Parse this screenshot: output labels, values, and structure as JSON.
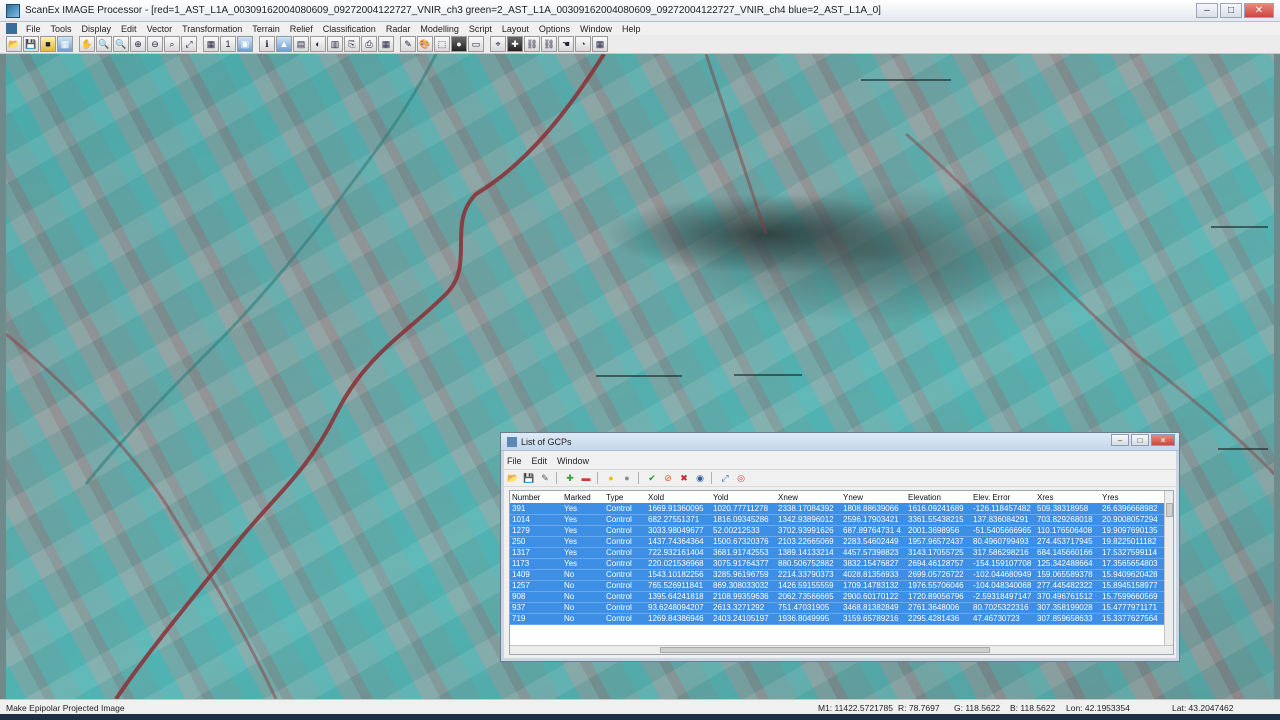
{
  "window": {
    "title": "ScanEx IMAGE Processor - [red=1_AST_L1A_00309162004080609_09272004122727_VNIR_ch3  green=2_AST_L1A_00309162004080609_09272004122727_VNIR_ch4  blue=2_AST_L1A_0]",
    "controls": {
      "minimize": "–",
      "maximize": "□",
      "close": "✕"
    }
  },
  "menubar": [
    "File",
    "Tools",
    "Display",
    "Edit",
    "Vector",
    "Transformation",
    "Terrain",
    "Relief",
    "Classification",
    "Radar",
    "Modelling",
    "Script",
    "Layout",
    "Options",
    "Window",
    "Help"
  ],
  "toolbar": {
    "icons": [
      "open-icon",
      "save-icon",
      "yellow-icon",
      "layers-icon",
      "pan-icon",
      "zoom-in-icon",
      "zoom-out-icon",
      "zoom-box-icon",
      "zoom-fit-icon",
      "zoom-icon",
      "fit-window-icon",
      "grid-icon",
      "zoom-actual-icon",
      "frame-icon",
      "info-icon",
      "blue-chart-icon",
      "histogram-icon",
      "contrast-icon",
      "band-icon",
      "copy-icon",
      "print-icon",
      "grid2-icon",
      "tool-icon",
      "color-icon",
      "select-icon",
      "record-icon",
      "window-icon",
      "pin-icon",
      "crosshair-icon",
      "link-icon",
      "link2-icon",
      "hand-icon",
      "gauge-icon",
      "table-icon"
    ],
    "glyphs": [
      "📂",
      "💾",
      "■",
      "▦",
      "✋",
      "🔍",
      "🔍",
      "⊕",
      "⊖",
      "⌕",
      "⤢",
      "▦",
      "1",
      "▣",
      "ℹ",
      "▲",
      "▤",
      "◐",
      "▥",
      "⎘",
      "⎙",
      "▦",
      "✎",
      "🎨",
      "⬚",
      "●",
      "▭",
      "⌖",
      "✚",
      "⛓",
      "⛓",
      "☚",
      "◔",
      "▦"
    ]
  },
  "gcp_dialog": {
    "title": "List of GCPs",
    "menu": [
      "File",
      "Edit",
      "Window"
    ],
    "controls": {
      "minimize": "–",
      "maximize": "□",
      "close": "✕"
    },
    "tools": [
      {
        "name": "open-icon",
        "glyph": "📂"
      },
      {
        "name": "save-icon",
        "glyph": "💾"
      },
      {
        "name": "edit-icon",
        "glyph": "✎"
      },
      {
        "name": "add-point-icon",
        "glyph": "✚"
      },
      {
        "name": "remove-point-icon",
        "glyph": "▬"
      },
      {
        "name": "yellow-circle-icon",
        "glyph": "●"
      },
      {
        "name": "gray-circle-icon",
        "glyph": "●"
      },
      {
        "name": "check-icon",
        "glyph": "✔"
      },
      {
        "name": "stop-icon",
        "glyph": "⊘"
      },
      {
        "name": "delete-icon",
        "glyph": "✖"
      },
      {
        "name": "globe-icon",
        "glyph": "◉"
      },
      {
        "name": "link-icon",
        "glyph": "⤢"
      },
      {
        "name": "target-icon",
        "glyph": "◎"
      }
    ],
    "columns": [
      "Number",
      "Marked",
      "Type",
      "Xold",
      "Yold",
      "Xnew",
      "Ynew",
      "Elevation",
      "Elev. Error",
      "Xres",
      "Yres"
    ],
    "rows": [
      [
        "391",
        "Yes",
        "Control",
        "1669.91360095",
        "1020.77711278",
        "2338.17084392",
        "1808.88639066",
        "1616.09241689",
        "-126.118457482",
        "509.38318958",
        "26.6396668982"
      ],
      [
        "1014",
        "Yes",
        "Control",
        "682.27551371",
        "1816.09345286",
        "1342.93896012",
        "2596.17903421",
        "3361.55438215",
        "137.836084291",
        "703.829268018",
        "20.9008057294"
      ],
      [
        "1279",
        "Yes",
        "Control",
        "3033.98049677",
        "52.00212533",
        "3702.93991626",
        "687.89764731 4",
        "2001.3698956",
        "-51.5405666965",
        "110.176506408",
        "19.9097690135"
      ],
      [
        "250",
        "Yes",
        "Control",
        "1437.74364364",
        "1500.67320376",
        "2103.22665069",
        "2283.54602449",
        "1957.96572437",
        "80.4960799493",
        "274.453717945",
        "19.8225011182"
      ],
      [
        "1317",
        "Yes",
        "Control",
        "722.932161404",
        "3681.91742553",
        "1389.14133214",
        "4457.57398823",
        "3143.17055725",
        "317.586298216",
        "684.145660166",
        "17.5327599114"
      ],
      [
        "1173",
        "Yes",
        "Control",
        "220.021536968",
        "3075.91764377",
        "880.506752882",
        "3832.15476827",
        "2694.46128757",
        "-154.159107708",
        "125.342488664",
        "17.3565654803"
      ],
      [
        "1409",
        "No",
        "Control",
        "1543.10182256",
        "3285.96196759",
        "2214.33790373",
        "4028.81356933",
        "2699.05726722",
        "-102.044680949",
        "159.065589378",
        "15.9409620428"
      ],
      [
        "1257",
        "No",
        "Control",
        "765.526911841",
        "869.308033032",
        "1426.59155559",
        "1709.14783132",
        "1976.55706046",
        "-104.048340068",
        "277.445482322",
        "15.8945158977"
      ],
      [
        "908",
        "No",
        "Control",
        "1395.64241818",
        "2108.99359636",
        "2062.73566665",
        "2900.60170122",
        "1720.89056796",
        "-2.59318497147",
        "370.496761512",
        "15.7599660569"
      ],
      [
        "937",
        "No",
        "Control",
        "93.6248094207",
        "2613.3271292",
        "751.47031905",
        "3468.81382849",
        "2761.3648006",
        "80.7025322316",
        "307.358199028",
        "15.4777971171"
      ],
      [
        "719",
        "No",
        "Control",
        "1269.84386946",
        "2403.24105197",
        "1936.8049995",
        "3159.65789216",
        "2295.4281436",
        "47.46730723",
        "307.859658633",
        "15.3377627564"
      ]
    ]
  },
  "statusbar": {
    "message": "Make Epipolar Projected Image",
    "m1": "M1:  11422.5721785",
    "r": "R:  78.7697",
    "g": "G:  118.5622",
    "b": "B:  118.5622",
    "lon": "Lon:  42.1953354",
    "lat": "Lat:  43.2047462"
  }
}
